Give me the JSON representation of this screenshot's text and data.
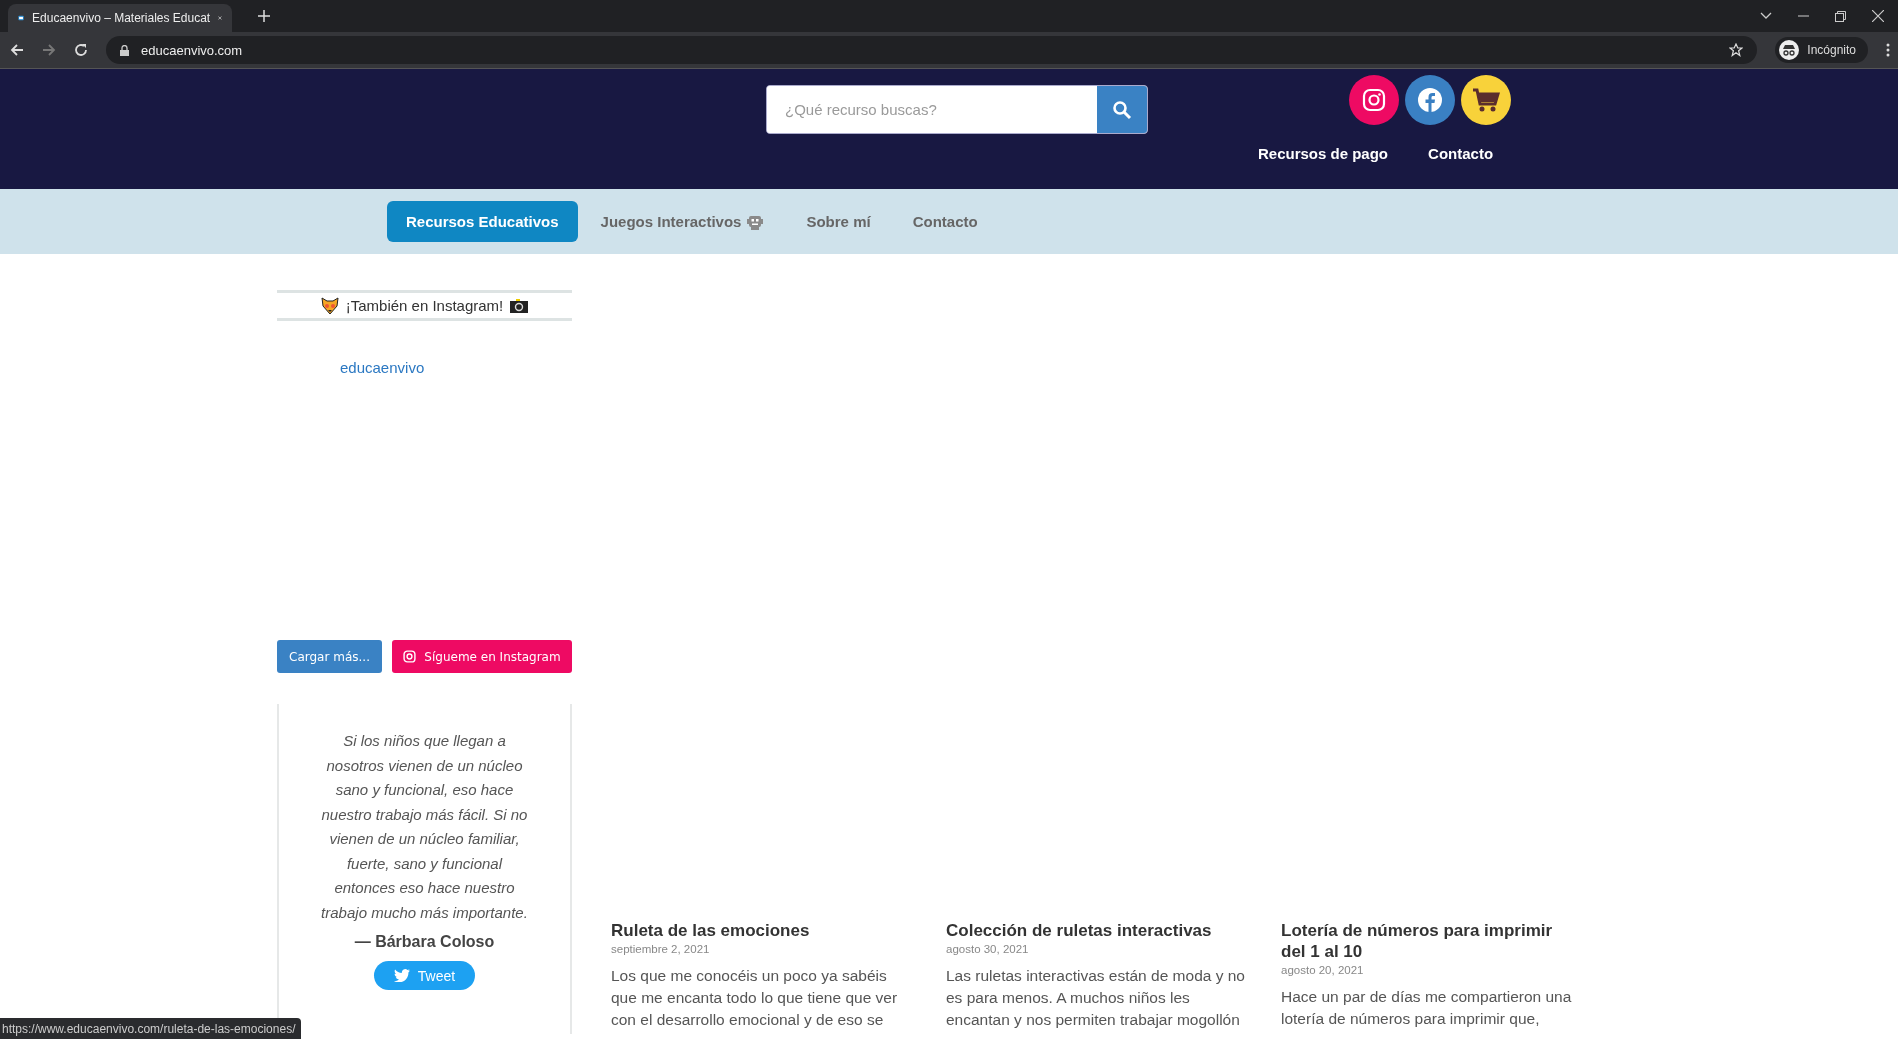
{
  "browser": {
    "tab_title": "Educaenvivo – Materiales Educat",
    "url": "educaenvivo.com",
    "profile_label": "Incógnito"
  },
  "header": {
    "search": {
      "placeholder": "¿Qué recurso buscas?"
    },
    "social": [
      {
        "kind": "instagram",
        "color": "#ee0a63"
      },
      {
        "kind": "facebook",
        "color": "#3a80c3"
      },
      {
        "kind": "cart",
        "color": "#f8d23a"
      }
    ],
    "links": [
      "Recursos de pago",
      "Contacto"
    ]
  },
  "nav": [
    {
      "label": "Recursos Educativos",
      "selected": true,
      "robot": false
    },
    {
      "label": "Juegos Interactivos",
      "selected": false,
      "robot": true
    },
    {
      "label": "Sobre mí",
      "selected": false,
      "robot": false
    },
    {
      "label": "Contacto",
      "selected": false,
      "robot": false
    }
  ],
  "sidebar": {
    "instagram_heading": "¡También en Instagram!",
    "username": "educaenvivo",
    "load_more": "Cargar más...",
    "follow": "Sígueme en Instagram",
    "quote": {
      "text": "Si los niños que llegan a nosotros vienen de un núcleo sano y funcional, eso hace nuestro trabajo más fácil. Si no vienen de un núcleo familiar, fuerte, sano y funcional entonces eso hace nuestro trabajo mucho más importante.",
      "author": "— Bárbara Coloso",
      "tweet": "Tweet"
    }
  },
  "posts": [
    {
      "title": "Ruleta de las emociones",
      "date": "septiembre 2, 2021",
      "excerpt": "Los que me conocéis un poco ya sabéis que me encanta todo lo que tiene que ver con el desarrollo emocional y de eso se"
    },
    {
      "title": "Colección de ruletas interactivas",
      "date": "agosto 30, 2021",
      "excerpt": "Las ruletas interactivas están de moda y no es para menos. A muchos niños les encantan y nos permiten trabajar mogollón"
    },
    {
      "title": "Lotería de números para imprimir del 1 al 10",
      "date": "agosto 20, 2021",
      "excerpt": "Hace un par de días me compartieron una lotería de números para imprimir que,"
    }
  ],
  "status_url": "https://www.educaenvivo.com/ruleta-de-las-emociones/"
}
